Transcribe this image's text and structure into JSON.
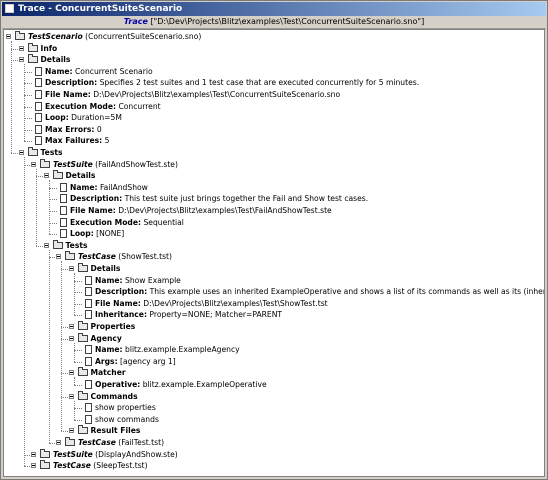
{
  "window": {
    "title": "Trace - ConcurrentSuiteScenario"
  },
  "header": {
    "label": "Trace",
    "path": "[\"D:\\Dev\\Projects\\Blitz\\examples\\Test\\ConcurrentSuiteScenario.sno\"]"
  },
  "tree": [
    {
      "level": 0,
      "kind": "folder",
      "label": "TestScenario",
      "style": "it",
      "rest": " (ConcurrentSuiteScenario.sno)",
      "expanded": true
    },
    {
      "level": 1,
      "kind": "folder",
      "label": "Info",
      "rest": "",
      "expanded": true
    },
    {
      "level": 1,
      "kind": "folder",
      "label": "Details",
      "rest": "",
      "expanded": true
    },
    {
      "level": 2,
      "kind": "doc",
      "label": "Name:",
      "rest": " Concurrent Scenario"
    },
    {
      "level": 2,
      "kind": "doc",
      "label": "Description:",
      "rest": " Specifies 2 test suites and 1 test case that are executed concurrently for 5 minutes."
    },
    {
      "level": 2,
      "kind": "doc",
      "label": "File Name:",
      "rest": " D:\\Dev\\Projects\\Blitz\\examples\\Test\\ConcurrentSuiteScenario.sno"
    },
    {
      "level": 2,
      "kind": "doc",
      "label": "Execution Mode:",
      "rest": " Concurrent"
    },
    {
      "level": 2,
      "kind": "doc",
      "label": "Loop:",
      "rest": " Duration=5M"
    },
    {
      "level": 2,
      "kind": "doc",
      "label": "Max Errors:",
      "rest": " 0"
    },
    {
      "level": 2,
      "kind": "doc",
      "label": "Max Failures:",
      "rest": " 5"
    },
    {
      "level": 1,
      "kind": "folder",
      "label": "Tests",
      "rest": "",
      "expanded": true
    },
    {
      "level": 2,
      "kind": "folder",
      "label": "TestSuite",
      "style": "it",
      "rest": " (FailAndShowTest.ste)",
      "expanded": true
    },
    {
      "level": 3,
      "kind": "folder",
      "label": "Details",
      "rest": "",
      "expanded": true
    },
    {
      "level": 4,
      "kind": "doc",
      "label": "Name:",
      "rest": " FailAndShow"
    },
    {
      "level": 4,
      "kind": "doc",
      "label": "Description:",
      "rest": " This test suite just brings together the Fail and Show test cases."
    },
    {
      "level": 4,
      "kind": "doc",
      "label": "File Name:",
      "rest": " D:\\Dev\\Projects\\Blitz\\examples\\Test\\FailAndShowTest.ste"
    },
    {
      "level": 4,
      "kind": "doc",
      "label": "Execution Mode:",
      "rest": " Sequential"
    },
    {
      "level": 4,
      "kind": "doc",
      "label": "Loop:",
      "rest": " [NONE]"
    },
    {
      "level": 3,
      "kind": "folder",
      "label": "Tests",
      "rest": "",
      "expanded": true
    },
    {
      "level": 4,
      "kind": "folder",
      "label": "TestCase",
      "style": "it",
      "rest": " (ShowTest.tst)",
      "expanded": true
    },
    {
      "level": 5,
      "kind": "folder",
      "label": "Details",
      "rest": "",
      "expanded": true
    },
    {
      "level": 6,
      "kind": "doc",
      "label": "Name:",
      "rest": " Show Example"
    },
    {
      "level": 6,
      "kind": "doc",
      "label": "Description:",
      "rest": " This example uses an inherited ExampleOperative and shows a list of its commands as well as its (inherited) properties."
    },
    {
      "level": 6,
      "kind": "doc",
      "label": "File Name:",
      "rest": " D:\\Dev\\Projects\\Blitz\\examples\\Test\\ShowTest.tst"
    },
    {
      "level": 6,
      "kind": "doc",
      "label": "Inheritance:",
      "rest": " Property=NONE; Matcher=PARENT"
    },
    {
      "level": 5,
      "kind": "folder",
      "label": "Properties",
      "rest": "",
      "expanded": true
    },
    {
      "level": 5,
      "kind": "folder",
      "label": "Agency",
      "rest": "",
      "expanded": true
    },
    {
      "level": 6,
      "kind": "doc",
      "label": "Name:",
      "rest": " blitz.example.ExampleAgency"
    },
    {
      "level": 6,
      "kind": "doc",
      "label": "Args:",
      "rest": " [agency arg 1]"
    },
    {
      "level": 5,
      "kind": "folder",
      "label": "Matcher",
      "rest": "",
      "expanded": true
    },
    {
      "level": 6,
      "kind": "doc",
      "label": "Operative:",
      "rest": " blitz.example.ExampleOperative"
    },
    {
      "level": 5,
      "kind": "folder",
      "label": "Commands",
      "rest": "",
      "expanded": true
    },
    {
      "level": 6,
      "kind": "doc",
      "label": "",
      "rest": "show properties"
    },
    {
      "level": 6,
      "kind": "doc",
      "label": "",
      "rest": "show commands"
    },
    {
      "level": 5,
      "kind": "folder",
      "label": "Result Files",
      "rest": "",
      "expanded": true
    },
    {
      "level": 4,
      "kind": "folder",
      "label": "TestCase",
      "style": "it",
      "rest": " (FailTest.tst)",
      "expanded": true
    },
    {
      "level": 2,
      "kind": "folder",
      "label": "TestSuite",
      "style": "it",
      "rest": " (DisplayAndShow.ste)",
      "expanded": true
    },
    {
      "level": 2,
      "kind": "folder",
      "label": "TestCase",
      "style": "it",
      "rest": " (SleepTest.tst)",
      "expanded": true
    }
  ]
}
